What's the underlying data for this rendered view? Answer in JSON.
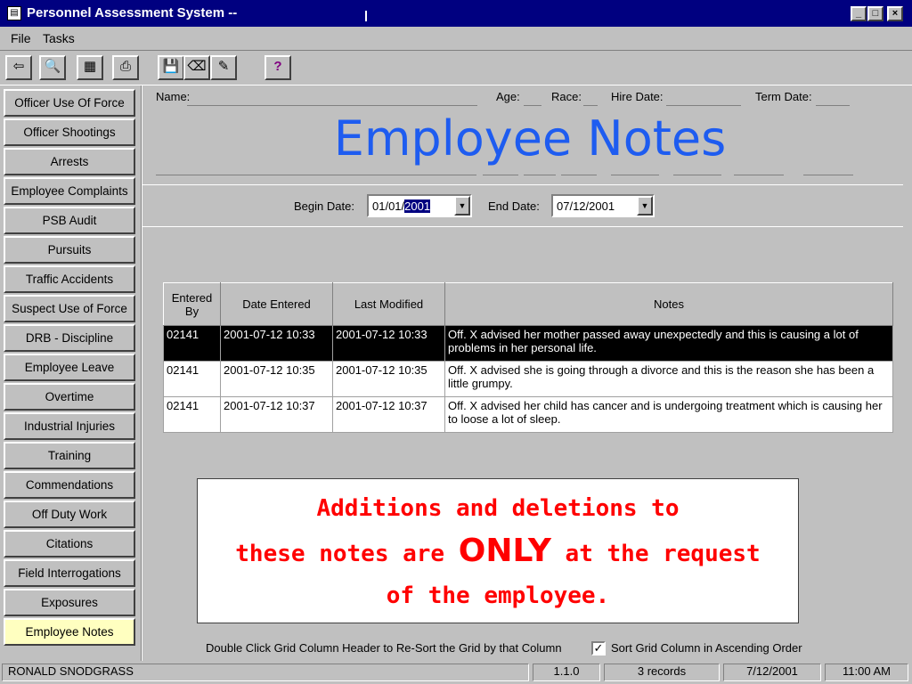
{
  "window": {
    "title": "Personnel Assessment System --",
    "sys_icon": "form-icon",
    "buttons": {
      "minimize": "_",
      "maximize": "□",
      "close": "×"
    }
  },
  "menu": [
    "File",
    "Tasks"
  ],
  "toolbar": [
    {
      "name": "exit-icon",
      "glyph": "⇦"
    },
    {
      "name": "binoculars-icon",
      "glyph": "🔍"
    },
    {
      "name": "record-icon",
      "glyph": "▦"
    },
    {
      "name": "print-icon",
      "glyph": "⎙"
    },
    {
      "name": "save-icon",
      "glyph": "💾"
    },
    {
      "name": "eraser-icon",
      "glyph": "⌫"
    },
    {
      "name": "pencil-icon",
      "glyph": "✎"
    },
    {
      "name": "help-icon",
      "glyph": "?"
    }
  ],
  "sidebar": [
    "Officer Use Of Force",
    "Officer Shootings",
    "Arrests",
    "Employee Complaints",
    "PSB Audit",
    "Pursuits",
    "Traffic Accidents",
    "Suspect Use of Force",
    "DRB - Discipline",
    "Employee Leave",
    "Overtime",
    "Industrial Injuries",
    "Training",
    "Commendations",
    "Off Duty Work",
    "Citations",
    "Field Interrogations",
    "Exposures",
    "Employee Notes"
  ],
  "active_item": "Employee Notes",
  "header": {
    "name_label": "Name:",
    "age_label": "Age:",
    "race_label": "Race:",
    "hire_label": "Hire Date:",
    "term_label": "Term Date:"
  },
  "page_title": "Employee Notes",
  "filters": {
    "begin_label": "Begin Date:",
    "begin_prefix": "01/01/",
    "begin_selected": "2001",
    "end_label": "End Date:",
    "end_value": "07/12/2001"
  },
  "grid": {
    "columns": [
      "Entered By",
      "Date Entered",
      "Last Modified",
      "Notes"
    ],
    "rows": [
      [
        "02141",
        "2001-07-12 10:33",
        "2001-07-12 10:33",
        "Off. X advised her mother passed away unexpectedly and this is causing a lot of problems in her personal life."
      ],
      [
        "02141",
        "2001-07-12 10:35",
        "2001-07-12 10:35",
        "Off. X advised she is going through a divorce and this is the reason she has been a little grumpy."
      ],
      [
        "02141",
        "2001-07-12 10:37",
        "2001-07-12 10:37",
        "Off. X advised her child has cancer and is undergoing treatment which is causing her to loose a lot of sleep."
      ]
    ],
    "selected_row": 0
  },
  "notice": {
    "line1": "Additions and deletions to",
    "line2_pre": "these notes are",
    "line2_emph": "ONLY",
    "line2_post": "at the request",
    "line3": "of the employee."
  },
  "footer": {
    "hint": "Double Click Grid Column Header to Re-Sort the Grid by that Column",
    "sort_label": "Sort Grid Column in Ascending Order",
    "sort_checked": true,
    "check_glyph": "✓"
  },
  "status": {
    "user": "RONALD SNODGRASS",
    "version": "1.1.0",
    "records": "3 records",
    "date": "7/12/2001",
    "time": "11:00 AM"
  }
}
